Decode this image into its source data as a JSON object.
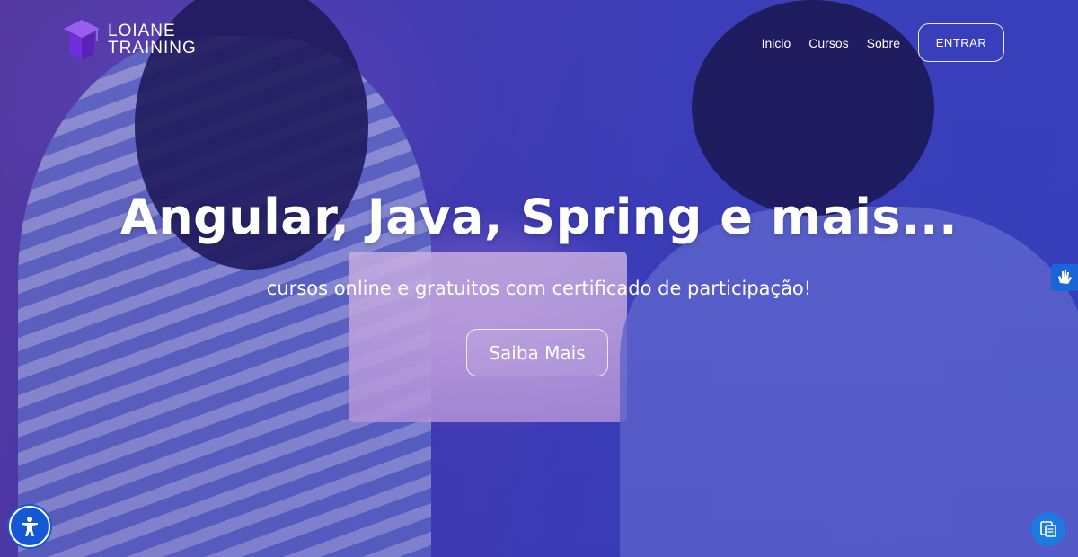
{
  "brand": {
    "line1": "LOIANE",
    "line2": "TRAINING",
    "logo_icon": "graduation-cap-icon",
    "accent": "#7b3fe4"
  },
  "nav": {
    "links": [
      "Inicio",
      "Cursos",
      "Sobre"
    ],
    "login_label": "ENTRAR"
  },
  "hero": {
    "headline": "Angular, Java, Spring e mais...",
    "subheadline": "cursos online e gratuitos com certificado de participação!",
    "cta_label": "Saiba Mais",
    "overlay_color": "#3f44c4"
  },
  "widgets": {
    "accessibility_icon": "accessibility-person-icon",
    "sign_language_icon": "sign-language-hands-icon",
    "chat_icon": "chat-support-icon",
    "accessibility_color": "#1558d6"
  }
}
